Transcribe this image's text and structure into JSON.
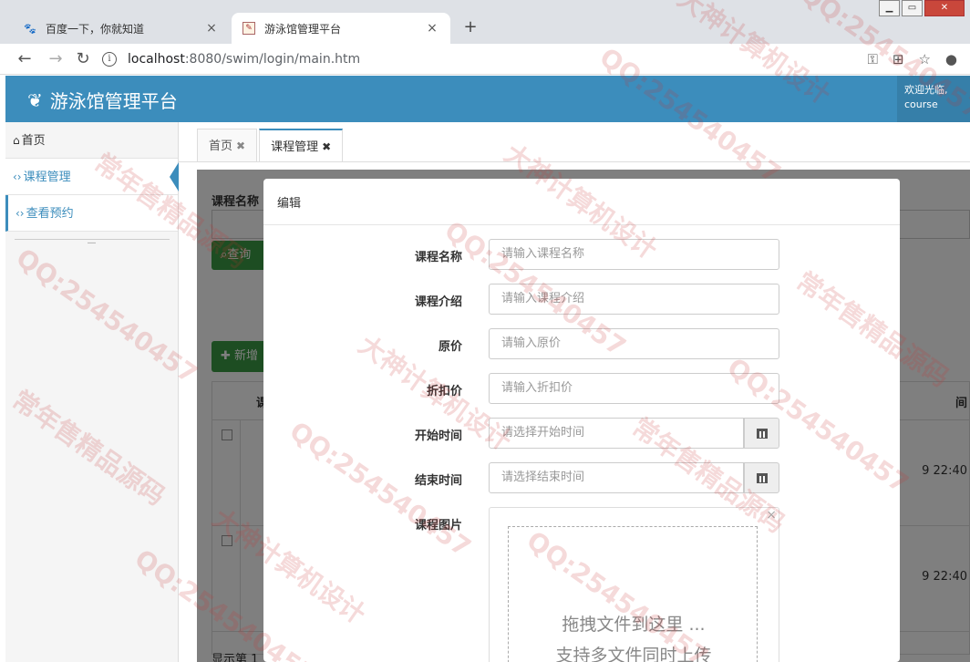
{
  "browser": {
    "tabs": [
      {
        "label": "百度一下，你就知道",
        "icon": "paw-icon"
      },
      {
        "label": "游泳馆管理平台",
        "icon": "page-icon"
      }
    ],
    "url_host": "localhost",
    "url_path": ":8080/swim/login/main.htm"
  },
  "app": {
    "title": "游泳馆管理平台",
    "welcome": "欢迎光临,",
    "username": "course"
  },
  "sidebar": {
    "items": [
      {
        "label": "首页"
      },
      {
        "label": "课程管理"
      },
      {
        "label": "查看预约"
      }
    ]
  },
  "content_tabs": [
    {
      "label": "首页"
    },
    {
      "label": "课程管理"
    }
  ],
  "page": {
    "filter_label": "课程名称",
    "search_button": "查询",
    "add_button": "新增",
    "table_header_left": "课",
    "table_header_right": "间",
    "rows": [
      {
        "time": "9 22:40"
      },
      {
        "time": "9 22:40"
      }
    ],
    "footer": "显示第 1"
  },
  "modal": {
    "title": "编辑",
    "fields": [
      {
        "label": "课程名称",
        "placeholder": "请输入课程名称"
      },
      {
        "label": "课程介绍",
        "placeholder": "请输入课程介绍"
      },
      {
        "label": "原价",
        "placeholder": "请输入原价"
      },
      {
        "label": "折扣价",
        "placeholder": "请输入折扣价"
      },
      {
        "label": "开始时间",
        "placeholder": "请选择开始时间"
      },
      {
        "label": "结束时间",
        "placeholder": "请选择结束时间"
      },
      {
        "label": "课程图片"
      }
    ],
    "upload_line1": "拖拽文件到这里 ...",
    "upload_line2": "支持多文件同时上传"
  },
  "watermark": {
    "texts": [
      "QQ:254540457",
      "大神计算机设计",
      "常年售精品源码"
    ]
  }
}
